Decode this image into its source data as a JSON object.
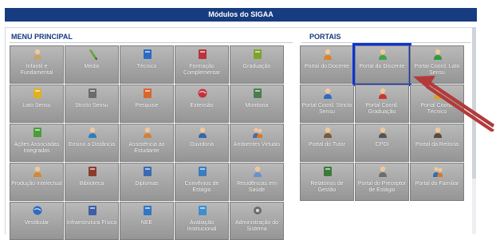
{
  "header": {
    "title": "Módulos do SIGAA"
  },
  "menu_principal": {
    "title": "MENU PRINCIPAL",
    "items": [
      {
        "label": "Infantil e Fundamental",
        "icon": "child-icon",
        "color": "#c7a26c"
      },
      {
        "label": "Médio",
        "icon": "pencil-icon",
        "color": "#5ba72f"
      },
      {
        "label": "Técnico",
        "icon": "book-icon",
        "color": "#2a6bc4"
      },
      {
        "label": "Formação Complementar",
        "icon": "book-icon",
        "color": "#b8343c"
      },
      {
        "label": "Graduação",
        "icon": "books-icon",
        "color": "#7ea32b"
      },
      {
        "label": "Lato Sensu",
        "icon": "folder-icon",
        "color": "#e0b21a"
      },
      {
        "label": "Stricto Sensu",
        "icon": "binder-icon",
        "color": "#6b6b6b"
      },
      {
        "label": "Pesquise",
        "icon": "flask-icon",
        "color": "#d9652b"
      },
      {
        "label": "Extensão",
        "icon": "globe-icon",
        "color": "#c7313a"
      },
      {
        "label": "Monitoria",
        "icon": "clipboard-icon",
        "color": "#4a7e4d"
      },
      {
        "label": "Ações Associadas Integradas",
        "icon": "puzzle-icon",
        "color": "#4b9d3c"
      },
      {
        "label": "Ensino a Distância",
        "icon": "globe-user-icon",
        "color": "#2c7fbf"
      },
      {
        "label": "Assistência ao Estudante",
        "icon": "student-icon",
        "color": "#d0813a"
      },
      {
        "label": "Ouvidoria",
        "icon": "ombudsman-icon",
        "color": "#3867a8"
      },
      {
        "label": "Ambientes Virtuais",
        "icon": "people-icon",
        "color": "#506aa0"
      },
      {
        "label": "Produção Intelectual",
        "icon": "user-edit-icon",
        "color": "#d48a2a"
      },
      {
        "label": "Biblioteca",
        "icon": "book-open-icon",
        "color": "#8a3d2c"
      },
      {
        "label": "Diplomas",
        "icon": "diploma-icon",
        "color": "#3a6bb0"
      },
      {
        "label": "Convênios de Estágio",
        "icon": "document-icon",
        "color": "#3a7ec0"
      },
      {
        "label": "Residências em Saúde",
        "icon": "doctor-icon",
        "color": "#6c8fcf"
      },
      {
        "label": "Vestibular",
        "icon": "swirl-icon",
        "color": "#2c6cc2"
      },
      {
        "label": "Infraestrutura Física",
        "icon": "building-icon",
        "color": "#3e5fa3"
      },
      {
        "label": "NEE",
        "icon": "wheelchair-icon",
        "color": "#3276c4"
      },
      {
        "label": "Avaliação Institucional",
        "icon": "checklist-icon",
        "color": "#3d8fd0"
      },
      {
        "label": "Administração do Sistema",
        "icon": "gear-icon",
        "color": "#6d6d6d"
      }
    ]
  },
  "portais": {
    "title": "PORTAIS",
    "items": [
      {
        "label": "Portal do Docente",
        "icon": "teacher-icon",
        "color": "#d6862a"
      },
      {
        "label": "Portal do Discente",
        "icon": "student-icon",
        "color": "#3fa443",
        "highlighted": true
      },
      {
        "label": "Portal Coord. Lato Sensu",
        "icon": "user-icon",
        "color": "#2e9a3c"
      },
      {
        "label": "Portal Coord. Stricto Sensu",
        "icon": "user-icon",
        "color": "#2d6bc2"
      },
      {
        "label": "Portal Coord. Graduação",
        "icon": "user-icon",
        "color": "#c8352c"
      },
      {
        "label": "Portal Coord. Técnico",
        "icon": "user-icon",
        "color": "#e0a020"
      },
      {
        "label": "Portal do Tutor",
        "icon": "tutor-icon",
        "color": "#7a5a3a"
      },
      {
        "label": "CPDI",
        "icon": "user-tie-icon",
        "color": "#555555"
      },
      {
        "label": "Portal da Reitoria",
        "icon": "rector-icon",
        "color": "#5a4a3a"
      },
      {
        "label": "Relatórios de Gestão",
        "icon": "report-icon",
        "color": "#3c7a3c"
      },
      {
        "label": "Portal do Preceptor de Estágio",
        "icon": "preceptor-icon",
        "color": "#6d6d6d"
      },
      {
        "label": "Portal do Familiar",
        "icon": "family-icon",
        "color": "#2f6db5"
      }
    ]
  }
}
